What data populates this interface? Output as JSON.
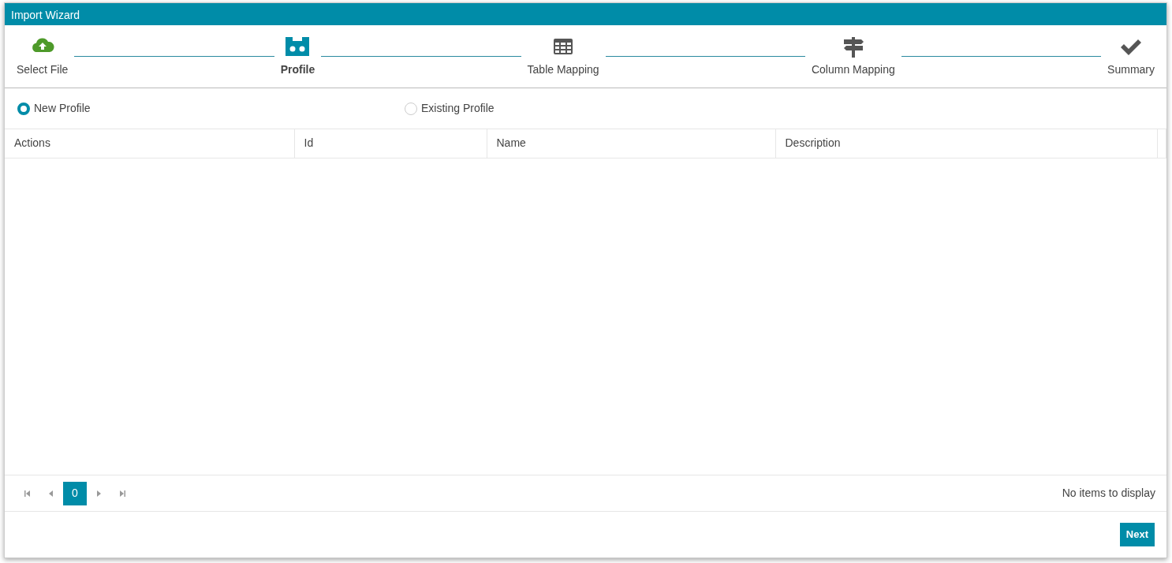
{
  "window": {
    "title": "Import Wizard"
  },
  "steps": [
    {
      "label": "Select File",
      "kind": "upload",
      "completed": true,
      "selected": false
    },
    {
      "label": "Profile",
      "kind": "profile",
      "completed": false,
      "selected": true
    },
    {
      "label": "Table Mapping",
      "kind": "table",
      "completed": false,
      "selected": false
    },
    {
      "label": "Column Mapping",
      "kind": "signpost",
      "completed": false,
      "selected": false
    },
    {
      "label": "Summary",
      "kind": "check",
      "completed": false,
      "selected": false
    }
  ],
  "profile_options": [
    {
      "label": "New Profile",
      "selected": true
    },
    {
      "label": "Existing Profile",
      "selected": false
    }
  ],
  "table": {
    "columns": [
      "Actions",
      "Id",
      "Name",
      "Description"
    ]
  },
  "pager": {
    "current_page": "0",
    "status": "No items to display"
  },
  "buttons": [
    "Next"
  ]
}
